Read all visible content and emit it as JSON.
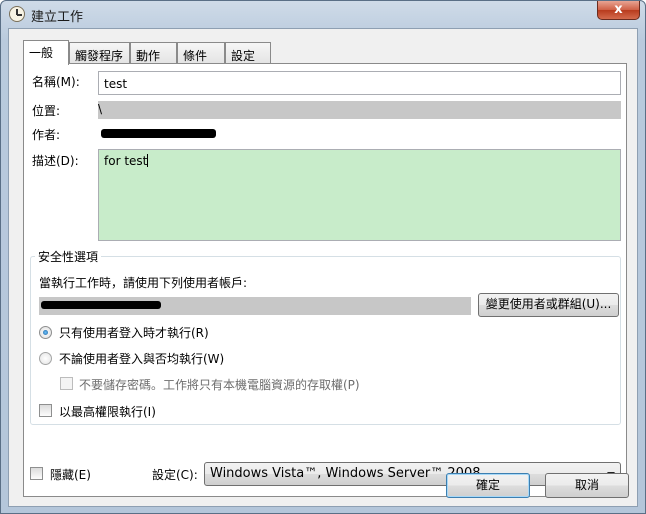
{
  "window": {
    "title": "建立工作",
    "close_glyph": "x"
  },
  "tabs": [
    {
      "label": "一般"
    },
    {
      "label": "觸發程序"
    },
    {
      "label": "動作"
    },
    {
      "label": "條件"
    },
    {
      "label": "設定"
    }
  ],
  "general": {
    "name_label": "名稱(M):",
    "name_value": "test",
    "location_label": "位置:",
    "location_value": "\\",
    "author_label": "作者:",
    "description_label": "描述(D):",
    "description_value": "for test",
    "description_bg": "#c8ecca"
  },
  "security": {
    "group_title": "安全性選項",
    "run_as_prompt": "當執行工作時，請使用下列使用者帳戶:",
    "change_user_button": "變更使用者或群組(U)...",
    "option_logged_on": "只有使用者登入時才執行(R)",
    "option_whether_logged_on": "不論使用者登入與否均執行(W)",
    "do_not_store_password": "不要儲存密碼。工作將只有本機電腦資源的存取權(P)",
    "highest_privileges": "以最高權限執行(I)"
  },
  "footer": {
    "hidden_label": "隱藏(E)",
    "configure_label": "設定(C):",
    "configure_value": "Windows Vista™, Windows Server™ 2008",
    "ok_button": "確定",
    "cancel_button": "取消"
  }
}
